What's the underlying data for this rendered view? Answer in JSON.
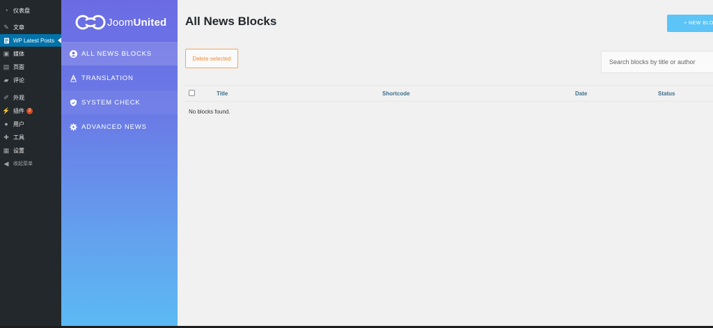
{
  "wp_menu": {
    "items": [
      {
        "label": "仪表盘",
        "icon": "dashboard-icon"
      },
      {
        "label": "文章",
        "icon": "pin-icon"
      },
      {
        "label": "WP Latest Posts",
        "icon": "posts-icon"
      },
      {
        "label": "媒体",
        "icon": "media-icon"
      },
      {
        "label": "页面",
        "icon": "page-icon"
      },
      {
        "label": "评论",
        "icon": "comment-icon"
      },
      {
        "label": "外观",
        "icon": "appearance-icon"
      },
      {
        "label": "插件",
        "icon": "plugin-icon",
        "badge": "2"
      },
      {
        "label": "用户",
        "icon": "user-icon"
      },
      {
        "label": "工具",
        "icon": "wrench-icon"
      },
      {
        "label": "设置",
        "icon": "settings-icon"
      },
      {
        "label": "收起菜单",
        "icon": "collapse-icon"
      }
    ]
  },
  "plugin": {
    "logo": {
      "light": "Joom",
      "bold": "United"
    },
    "nav": [
      {
        "label": "ALL NEWS BLOCKS",
        "icon": "user-circle-icon"
      },
      {
        "label": "TRANSLATION",
        "icon": "translation-icon"
      },
      {
        "label": "SYSTEM CHECK",
        "icon": "shield-check-icon"
      },
      {
        "label": "ADVANCED NEWS",
        "icon": "gear-icon"
      }
    ]
  },
  "main": {
    "title": "All News Blocks",
    "new_block_label": "+ NEW BLO",
    "delete_label": "Delete selected",
    "search_placeholder": "Search blocks by title or author",
    "columns": {
      "title": "Title",
      "shortcode": "Shortcode",
      "date": "Date",
      "status": "Status"
    },
    "empty_message": "No blocks found."
  },
  "colors": {
    "wp_sidebar": "#23282d",
    "wp_active": "#0073aa",
    "accent_orange": "#f08a2e",
    "new_button": "#5cc4f7",
    "gradient_top": "#6b6ce3",
    "gradient_bottom": "#5bbaf3"
  }
}
